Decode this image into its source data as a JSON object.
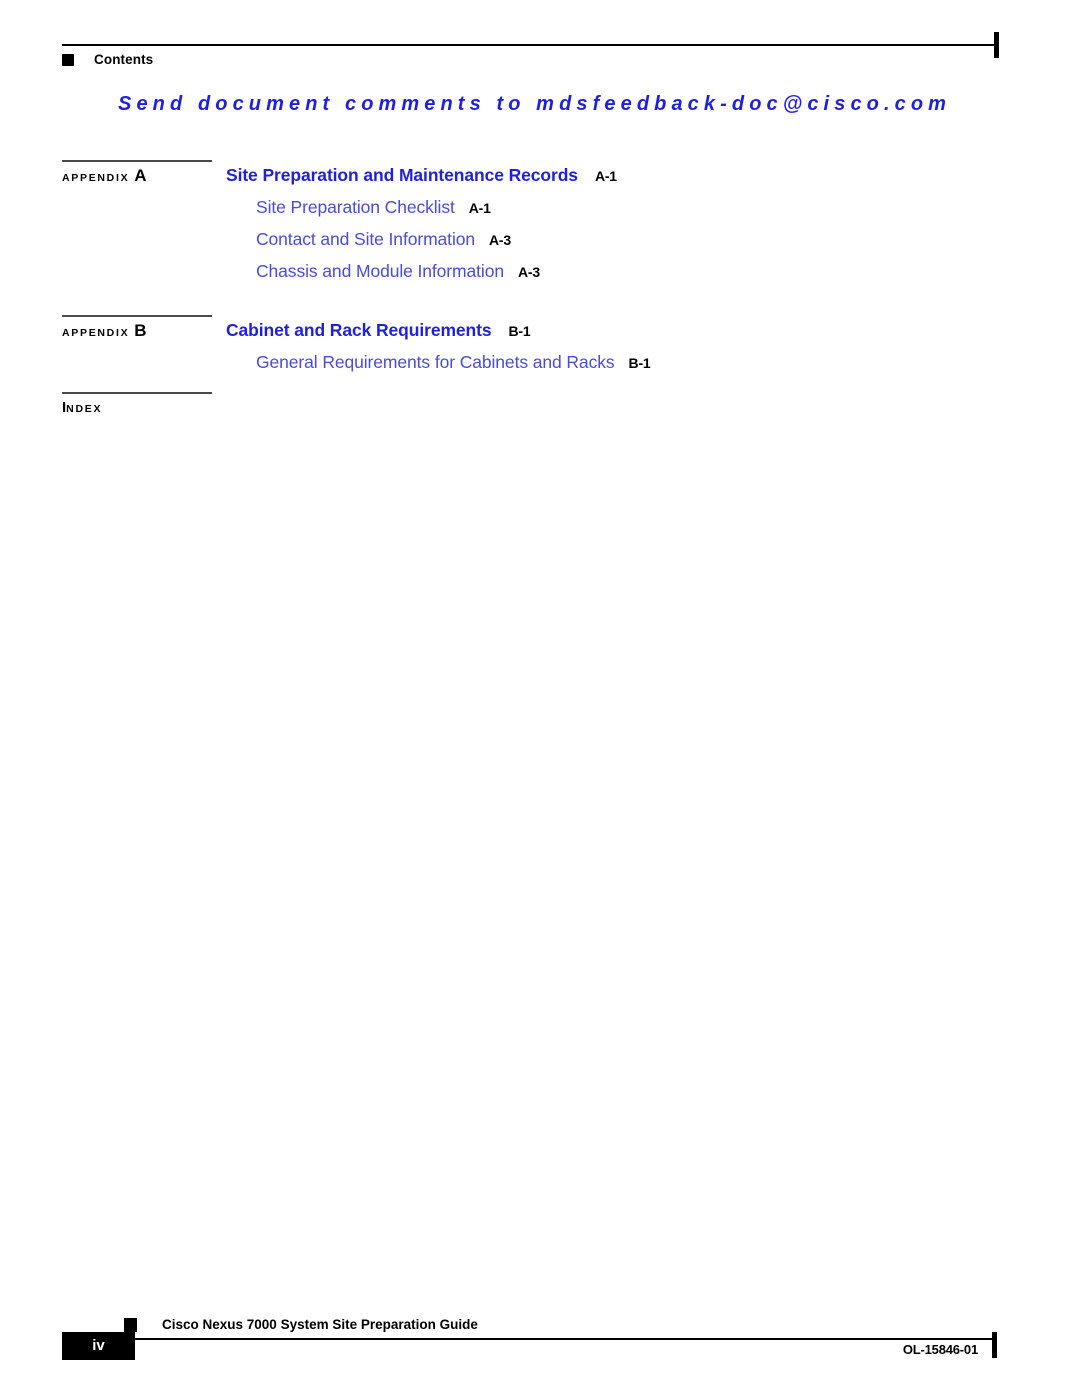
{
  "running_head": {
    "label": "Contents",
    "marker_icon": "square-bullet-icon"
  },
  "feedback_banner": {
    "text": "Send document comments to mdsfeedback-doc@cisco.com",
    "color": "#1f1fe0"
  },
  "toc": {
    "groups": [
      {
        "gutter_word": "APPENDIX",
        "gutter_letter": "A",
        "title": "Site Preparation and Maintenance Records",
        "page": "A-1",
        "sections": [
          {
            "title": "Site Preparation Checklist",
            "page": "A-1"
          },
          {
            "title": "Contact and Site Information",
            "page": "A-3"
          },
          {
            "title": "Chassis and Module Information",
            "page": "A-3"
          }
        ]
      },
      {
        "gutter_word": "APPENDIX",
        "gutter_letter": "B",
        "title": "Cabinet and Rack Requirements",
        "page": "B-1",
        "sections": [
          {
            "title": "General Requirements for Cabinets and Racks",
            "page": "B-1"
          }
        ]
      }
    ],
    "index": {
      "cap": "I",
      "rest": "NDEX"
    }
  },
  "footer": {
    "guide_title": "Cisco Nexus 7000 System Site Preparation Guide",
    "page_number": "iv",
    "doc_number": "OL-15846-01",
    "marker_icon": "square-bullet-icon"
  }
}
